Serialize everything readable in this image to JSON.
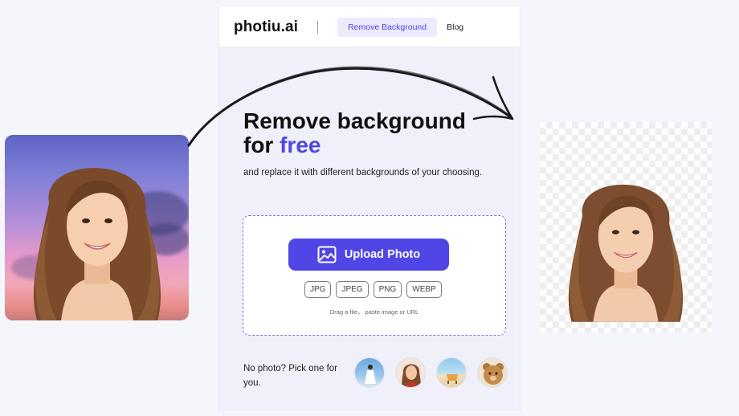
{
  "nav": {
    "logo": "photiu.ai",
    "active_link": "Remove Background",
    "blog_link": "Blog"
  },
  "hero": {
    "headline_line1": "Remove background",
    "headline_line2_prefix": "for ",
    "headline_accent": "free",
    "subtext": "and replace it with different backgrounds of your choosing."
  },
  "upload": {
    "button_label": "Upload Photo",
    "icon": "image-icon",
    "formats": [
      "JPG",
      "JPEG",
      "PNG",
      "WEBP"
    ],
    "hint": "Drag a file， paste image or URL"
  },
  "samples": {
    "label": "No photo? Pick one for you.",
    "items": [
      "sample-beach-dress",
      "sample-woman-portrait",
      "sample-beach-chair",
      "sample-teddy-bear"
    ]
  },
  "colors": {
    "accent": "#4f46e5",
    "panel_bg": "#f0f0fb",
    "page_bg": "#f4f6fb"
  }
}
